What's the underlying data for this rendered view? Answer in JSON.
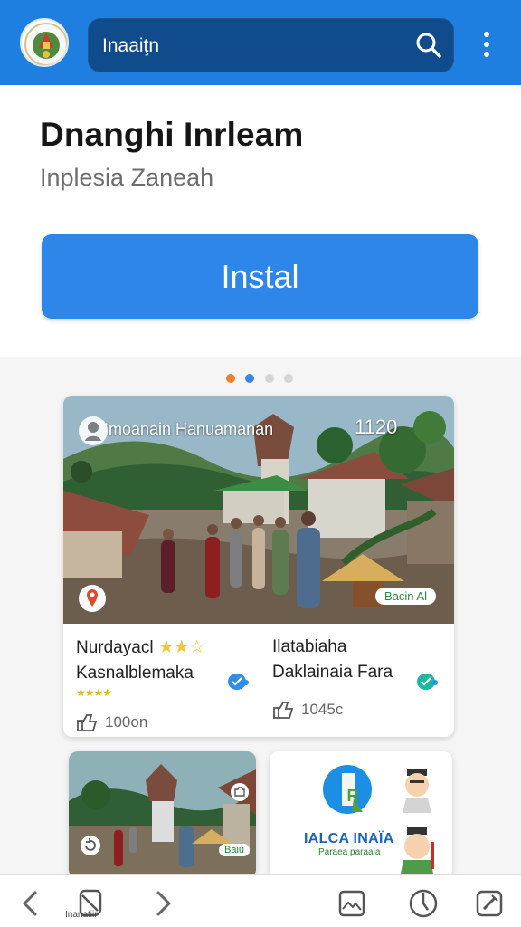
{
  "header": {
    "search_value": "Inaaiţn"
  },
  "app": {
    "title": "Dnanghi Inrleam",
    "subtitle": "Inplesia Zaneah",
    "install_label": "Instal"
  },
  "gallery": {
    "main_card": {
      "overlay_title": "Imoanain Hanuamanan",
      "overlay_counter": "1120",
      "chip_label": "Bacin Al",
      "left": {
        "line1": "Nurdayacl",
        "line2": "Kasnalblemaka",
        "count": "100on"
      },
      "right": {
        "line1": "Ilatabiaha",
        "line2": "Daklainaia Fara",
        "count": "1045c"
      }
    },
    "promo_card": {
      "title": "IALCA INAÏA",
      "subtitle": "Paraea paraala"
    },
    "small_chip": "Baiu"
  },
  "bottom_nav": {
    "label": "Inanatiir"
  },
  "colors": {
    "primary": "#1e7fe0",
    "install": "#2e86e8",
    "search_bg": "#104c8c"
  }
}
